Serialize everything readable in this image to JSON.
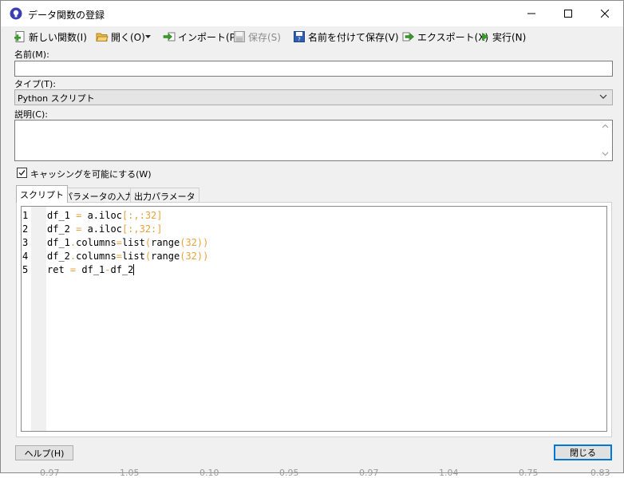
{
  "window": {
    "title": "データ関数の登録",
    "icon": "lightbulb-icon",
    "controls": {
      "minimize": "minimize-icon",
      "maximize": "maximize-icon",
      "close": "close-icon"
    }
  },
  "toolbar": {
    "new_label": "新しい関数(I)",
    "open_label": "開く(O)",
    "import_label": "インポート(P)",
    "save_label": "保存(S)",
    "save_as_label": "名前を付けて保存(V)",
    "export_label": "エクスポート(X)",
    "run_label": "実行(N)"
  },
  "form": {
    "name_label": "名前(M):",
    "name_value": "",
    "type_label": "タイプ(T):",
    "type_value": "Python スクリプト",
    "description_label": "説明(C):",
    "description_value": "",
    "caching_label": "キャッシングを可能にする(W)",
    "caching_checked": true
  },
  "tabs": [
    {
      "label": "スクリプト",
      "active": true
    },
    {
      "label": "パラメータの入力",
      "active": false
    },
    {
      "label": "出力パラメータ",
      "active": false
    }
  ],
  "editor": {
    "lines": [
      {
        "num": "1",
        "text": "df_1 = a.iloc[:,:32]"
      },
      {
        "num": "2",
        "text": "df_2 = a.iloc[:,32:]"
      },
      {
        "num": "3",
        "text": "df_1.columns=list(range(32))"
      },
      {
        "num": "4",
        "text": "df_2.columns=list(range(32))"
      },
      {
        "num": "5",
        "text": "ret = df_1-df_2"
      }
    ]
  },
  "footer": {
    "help_label": "ヘルプ(H)",
    "close_label": "閉じる"
  },
  "background_ticks": [
    "0.97",
    "1.05",
    "0.10",
    "0.95",
    "0.97",
    "1.04",
    "0.75",
    "0.83"
  ],
  "colors": {
    "accent": "#0078d7",
    "operator": "#e6a23c",
    "dialog_bg": "#f0f0f0",
    "run_icon": "#3a9a2a"
  }
}
